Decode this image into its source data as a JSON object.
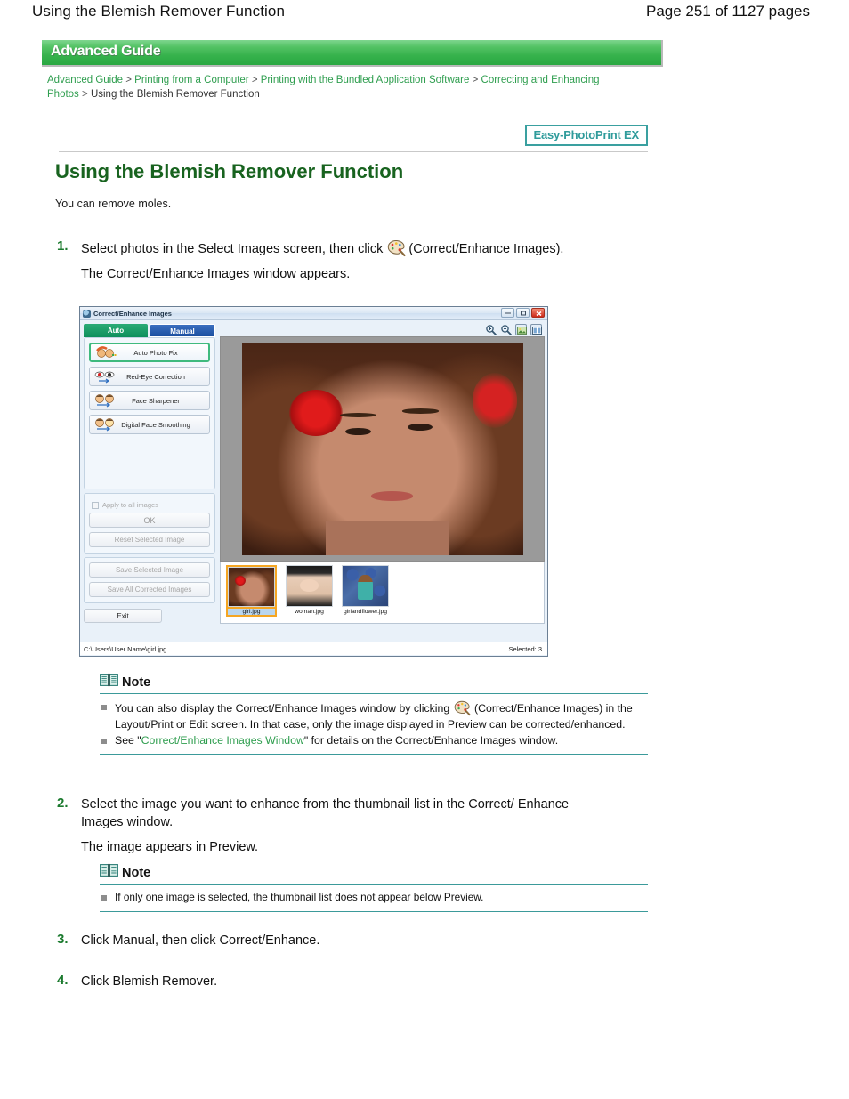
{
  "page_header": {
    "doc_title": "Using the Blemish Remover Function",
    "page_number": "Page 251 of 1127 pages"
  },
  "guide_banner": {
    "label": "Advanced Guide"
  },
  "breadcrumb": {
    "items": [
      "Advanced Guide",
      "Printing from a Computer",
      "Printing with the Bundled Application Software",
      "Correcting and Enhancing Photos",
      "Using the Blemish Remover Function"
    ],
    "separator": ">"
  },
  "badge": {
    "label": "Easy-PhotoPrint EX"
  },
  "main": {
    "title": "Using the Blemish Remover Function",
    "intro": "You can remove moles."
  },
  "steps": [
    {
      "number": "1.",
      "text_before_icon": "Select photos in the Select Images screen, then click",
      "icon": "palette-icon",
      "text_after_icon": "(Correct/Enhance Images).",
      "sub_text": "The Correct/Enhance Images window appears."
    },
    {
      "number": "2.",
      "text": "Select the image you want to enhance from the thumbnail list in the Correct/ Enhance Images window.",
      "sub_text": "The image appears in Preview."
    },
    {
      "number": "3.",
      "text": "Click Manual, then click Correct/Enhance."
    },
    {
      "number": "4.",
      "text": "Click Blemish Remover."
    }
  ],
  "note_one": {
    "title": "Note",
    "items": [
      {
        "part1": "You can also display the Correct/Enhance Images window by clicking",
        "icon": "palette-icon",
        "part2": "(Correct/Enhance Images) in the Layout/Print or Edit screen. In that case, only the image displayed in Preview can be corrected/enhanced."
      },
      {
        "part1": "See \"",
        "link": "Correct/Enhance Images Window",
        "part2": "\" for details on the Correct/Enhance Images window."
      }
    ]
  },
  "note_two": {
    "title": "Note",
    "items": [
      "If only one image is selected, the thumbnail list does not appear below Preview."
    ]
  },
  "app_window": {
    "title": "Correct/Enhance Images",
    "window_controls": [
      "minimize",
      "maximize",
      "close"
    ],
    "tabs": [
      {
        "label": "Auto",
        "active": true
      },
      {
        "label": "Manual",
        "active": false
      }
    ],
    "options": [
      {
        "label": "Auto Photo Fix",
        "selected": true
      },
      {
        "label": "Red-Eye Correction",
        "selected": false
      },
      {
        "label": "Face Sharpener",
        "selected": false
      },
      {
        "label": "Digital Face Smoothing",
        "selected": false
      }
    ],
    "apply_all_checkbox": "Apply to all images",
    "buttons": {
      "ok": "OK",
      "reset_selected": "Reset Selected Image",
      "save_selected": "Save Selected Image",
      "save_all": "Save All Corrected Images",
      "exit": "Exit"
    },
    "toolbar_icons": [
      "zoom-in-icon",
      "zoom-out-icon",
      "fit-image-icon",
      "compare-view-icon"
    ],
    "thumbnails": [
      {
        "name": "girl.jpg",
        "active": true
      },
      {
        "name": "woman.jpg",
        "active": false
      },
      {
        "name": "girlandflower.jpg",
        "active": false
      }
    ],
    "status_bar": {
      "path": "C:\\Users\\User Name\\girl.jpg",
      "selected": "Selected: 3"
    }
  },
  "colors": {
    "brand_green": "#18631f",
    "link_green": "#2f9e4f",
    "teal": "#2f9b9b",
    "note_rule": "#3b9a9a",
    "step_number": "#1b7a2e"
  }
}
